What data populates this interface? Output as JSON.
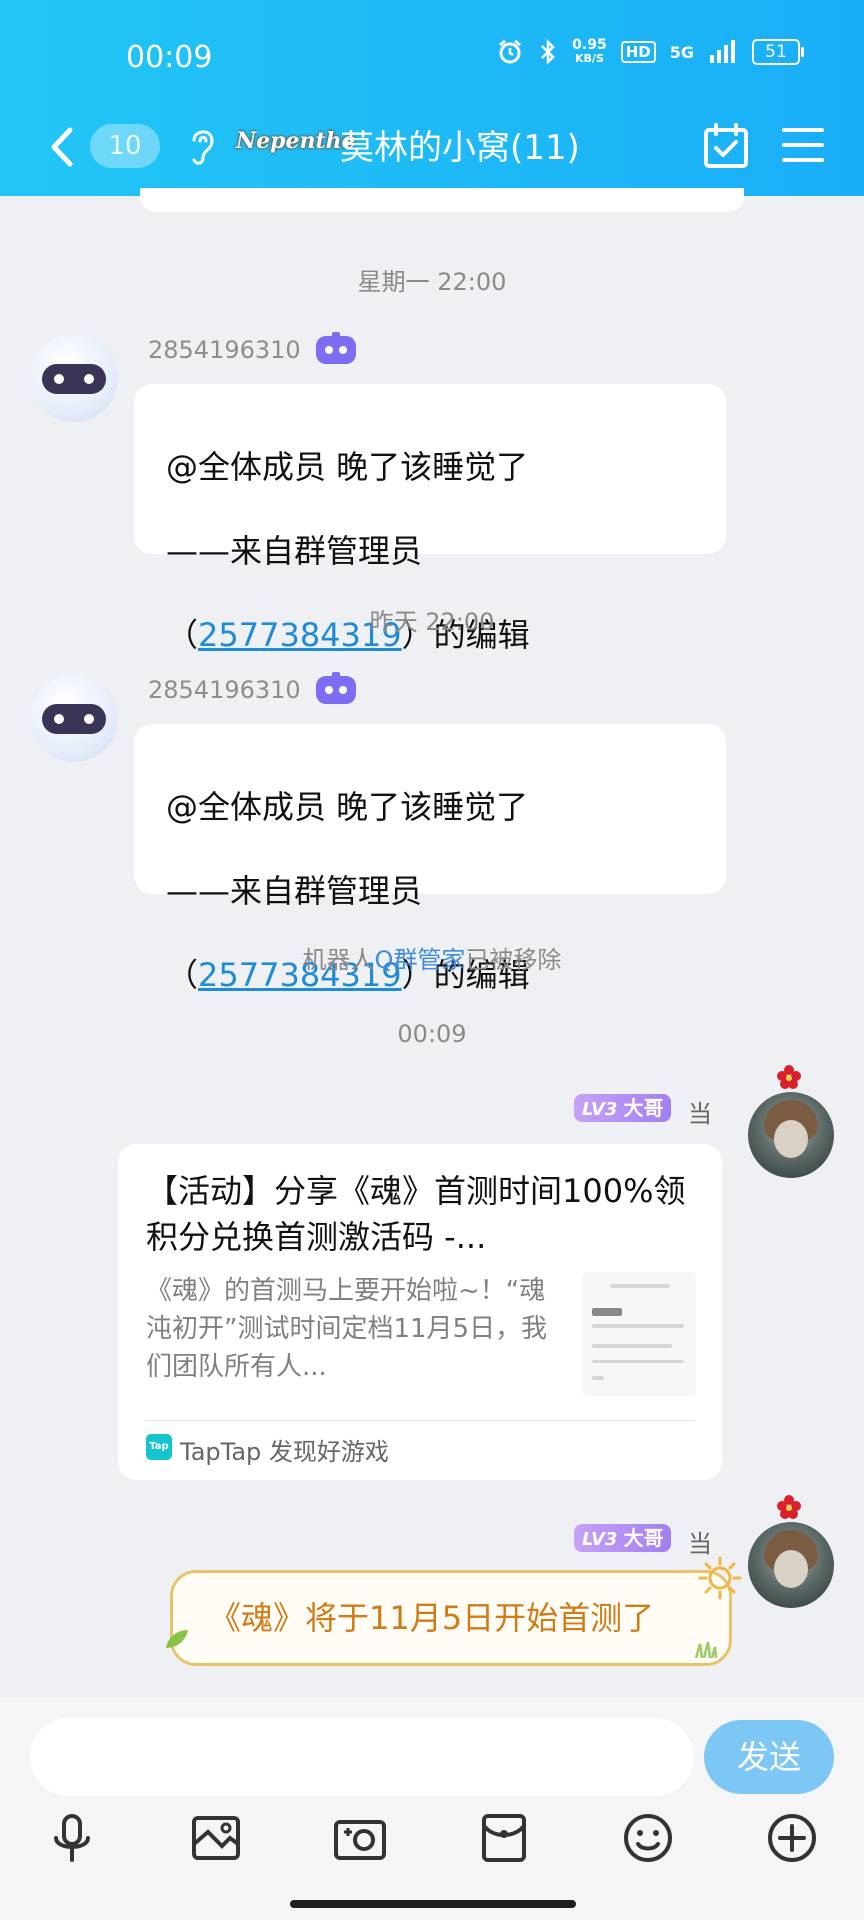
{
  "status_bar": {
    "time": "00:09",
    "net_speed_value": "0.95",
    "net_speed_unit": "KB/S",
    "hd": "HD",
    "signal": "5G",
    "battery": "51"
  },
  "nav": {
    "unread_count": "10",
    "group_logo_text": "Nepenthe",
    "group_title": "莫林的小窝(11)"
  },
  "messages": {
    "divider_1": "星期一 22:00",
    "divider_2": "昨天 22:00",
    "divider_3": "00:09",
    "bot_sender_id": "2854196310",
    "bot_msg_line1": "@全体成员 晚了该睡觉了",
    "bot_msg_line2": "——来自群管理员",
    "bot_msg_paren_open": "（",
    "bot_msg_admin_id": "2577384319",
    "bot_msg_paren_close": "）的编辑",
    "system_notice_prefix": "机器人",
    "system_notice_highlight": "Q群管家",
    "system_notice_suffix": "已被移除",
    "user_level_num": "LV3",
    "user_title": "大哥",
    "user_name_cutoff": "当",
    "share_title": "【活动】分享《魂》首测时间100%领积分兑换首测激活码 -...",
    "share_desc": "《魂》的首测马上要开始啦~！“魂沌初开”测试时间定档11月5日，我们团队所有人...",
    "share_source_logo": "Tap",
    "share_source": "TapTap 发现好游戏",
    "fancy_msg": "《魂》将于11月5日开始首测了"
  },
  "input": {
    "placeholder": "",
    "send_label": "发送"
  },
  "icons": {
    "back": "chevron-left-icon",
    "ear": "ear-icon",
    "calendar": "calendar-check-icon",
    "menu": "hamburger-menu-icon",
    "voice": "microphone-icon",
    "image": "image-icon",
    "camera": "camera-icon",
    "red_packet": "red-packet-icon",
    "emoji": "emoji-icon",
    "more": "plus-circle-icon"
  },
  "colors": {
    "header_start": "#22c6f5",
    "header_end": "#1aaef7",
    "link": "#1d8bd8",
    "level_badge": "#b08cf3",
    "fancy_text": "#d17b17",
    "send_button": "#7cc7f3"
  }
}
